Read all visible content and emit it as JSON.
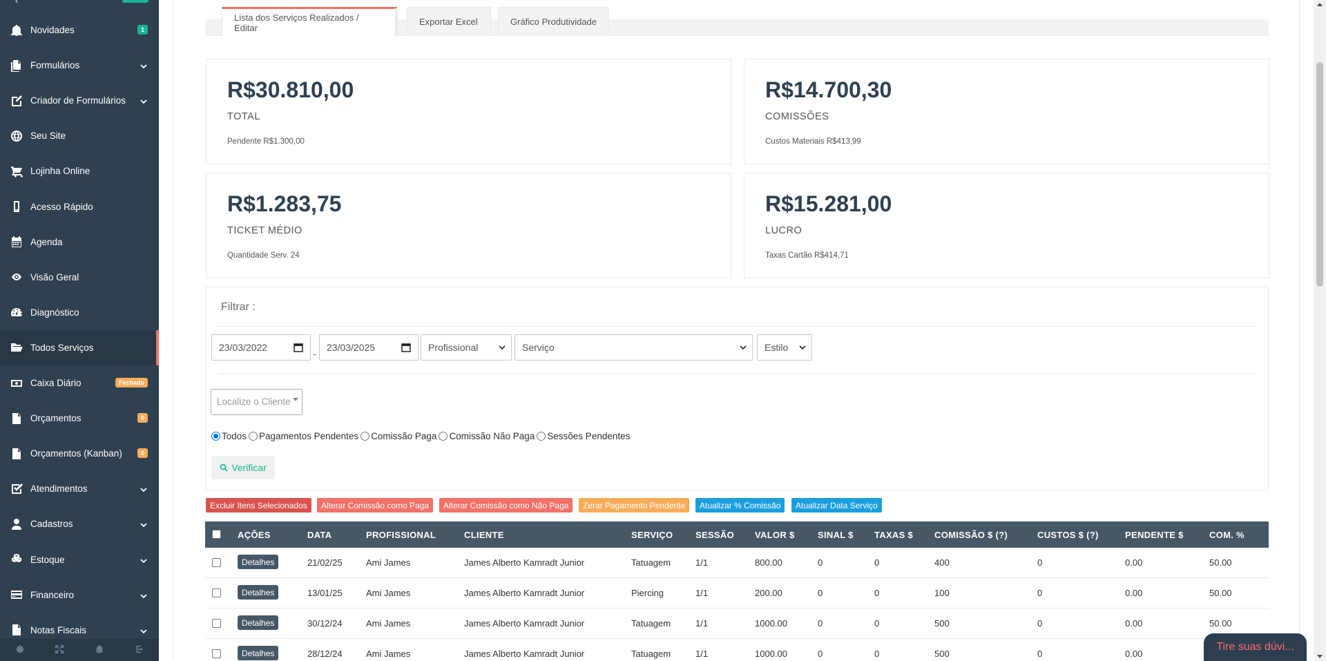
{
  "sidebar": {
    "items": [
      {
        "label": "Novidades",
        "icon": "bell-icon",
        "badge": "1",
        "badge_color": "green",
        "chevron": false,
        "active": false
      },
      {
        "label": "Formulários",
        "icon": "files-icon",
        "chevron": true,
        "active": false
      },
      {
        "label": "Criador de Formulários",
        "icon": "edit-icon",
        "chevron": true,
        "active": false
      },
      {
        "label": "Seu Site",
        "icon": "globe-icon",
        "chevron": false,
        "active": false
      },
      {
        "label": "Lojinha Online",
        "icon": "cart-icon",
        "chevron": false,
        "active": false
      },
      {
        "label": "Acesso Rápido",
        "icon": "mobile-icon",
        "chevron": false,
        "active": false
      },
      {
        "label": "Agenda",
        "icon": "calendar-icon",
        "chevron": false,
        "active": false
      },
      {
        "label": "Visão Geral",
        "icon": "eye-icon",
        "chevron": false,
        "active": false
      },
      {
        "label": "Diagnóstico",
        "icon": "dashboard-icon",
        "chevron": false,
        "active": false
      },
      {
        "label": "Todos Serviços",
        "icon": "folder-open-icon",
        "chevron": false,
        "active": true
      },
      {
        "label": "Caixa Diário",
        "icon": "money-icon",
        "badge": "Fechado",
        "badge_color": "orange",
        "chevron": false,
        "active": false
      },
      {
        "label": "Orçamentos",
        "icon": "file-text-icon",
        "badge": "0",
        "badge_color": "orange",
        "chevron": false,
        "active": false
      },
      {
        "label": "Orçamentos (Kanban)",
        "icon": "file-text-icon",
        "badge": "0",
        "badge_color": "orange",
        "chevron": false,
        "active": false
      },
      {
        "label": "Atendimentos",
        "icon": "check-square-icon",
        "chevron": true,
        "active": false
      },
      {
        "label": "Cadastros",
        "icon": "user-icon",
        "chevron": true,
        "active": false
      },
      {
        "label": "Estoque",
        "icon": "cubes-icon",
        "chevron": true,
        "active": false
      },
      {
        "label": "Financeiro",
        "icon": "credit-card-icon",
        "chevron": true,
        "active": false
      },
      {
        "label": "Notas Fiscais",
        "icon": "file-icon",
        "chevron": true,
        "active": false
      }
    ],
    "footer_icons": [
      "gear-icon",
      "expand-icon",
      "bell-icon",
      "logout-icon"
    ]
  },
  "tabs": [
    "Lista dos Serviços Realizados / Editar",
    "Exportar Excel",
    "Gráfico Produtividade"
  ],
  "stats": [
    {
      "value": "R$30.810,00",
      "label": "TOTAL",
      "sub": "Pendente R$1.300,00"
    },
    {
      "value": "R$14.700,30",
      "label": "COMISSÕES",
      "sub": "Custos Materiais R$413,99"
    },
    {
      "value": "R$1.283,75",
      "label": "TICKET MÉDIO",
      "sub": "Quantidade Serv. 24"
    },
    {
      "value": "R$15.281,00",
      "label": "LUCRO",
      "sub": "Taxas Cartão R$414,71"
    }
  ],
  "filter": {
    "title": "Filtrar :",
    "date_from": "23/03/2022",
    "date_separator": "-",
    "date_to": "23/03/2025",
    "professional": "Profissional",
    "service": "Serviço",
    "style": "Estilo",
    "client_placeholder": "Localize o Cliente",
    "radios": [
      {
        "label": "Todos",
        "checked": true
      },
      {
        "label": "Pagamentos Pendentes",
        "checked": false
      },
      {
        "label": "Comissão Paga",
        "checked": false
      },
      {
        "label": "Comissão Não Paga",
        "checked": false
      },
      {
        "label": "Sessões Pendentes",
        "checked": false
      }
    ],
    "verify_label": "Verificar"
  },
  "actions": [
    "Excluir Itens Selecionados",
    "Alterar Comissão como Paga",
    "Alterar Comissão como Não Paga",
    "Zerar Pagamento Pendente",
    "Atualizar % Comissão",
    "Atualizar Data Serviço"
  ],
  "table": {
    "headers": [
      "AÇÕES",
      "DATA",
      "PROFISSIONAL",
      "CLIENTE",
      "SERVIÇO",
      "SESSÃO",
      "VALOR $",
      "SINAL $",
      "TAXAS $",
      "COMISSÃO $ (?)",
      "CUSTOS $ (?)",
      "PENDENTE $",
      "COM. %"
    ],
    "details_label": "Detalhes",
    "rows": [
      [
        "21/02/25",
        "Ami James",
        "James Alberto Kamradt Junior",
        "Tatuagem",
        "1/1",
        "800.00",
        "0",
        "0",
        "400",
        "0",
        "0.00",
        "50.00"
      ],
      [
        "13/01/25",
        "Ami James",
        "James Alberto Kamradt Junior",
        "Piercing",
        "1/1",
        "200.00",
        "0",
        "0",
        "100",
        "0",
        "0.00",
        "50.00"
      ],
      [
        "30/12/24",
        "Ami James",
        "James Alberto Kamradt Junior",
        "Tatuagem",
        "1/1",
        "1000.00",
        "0",
        "0",
        "500",
        "0",
        "0.00",
        "50.00"
      ],
      [
        "28/12/24",
        "Ami James",
        "James Alberto Kamradt Junior",
        "Tatuagem",
        "1/1",
        "1000.00",
        "0",
        "0",
        "500",
        "0",
        "0.00",
        "50.00"
      ]
    ]
  },
  "chat": {
    "label": "Tire suas dúvi..."
  },
  "colors": {
    "sidebar": "#2f4050",
    "accent": "#f27168",
    "green": "#1ab394",
    "table_header": "#465766"
  }
}
